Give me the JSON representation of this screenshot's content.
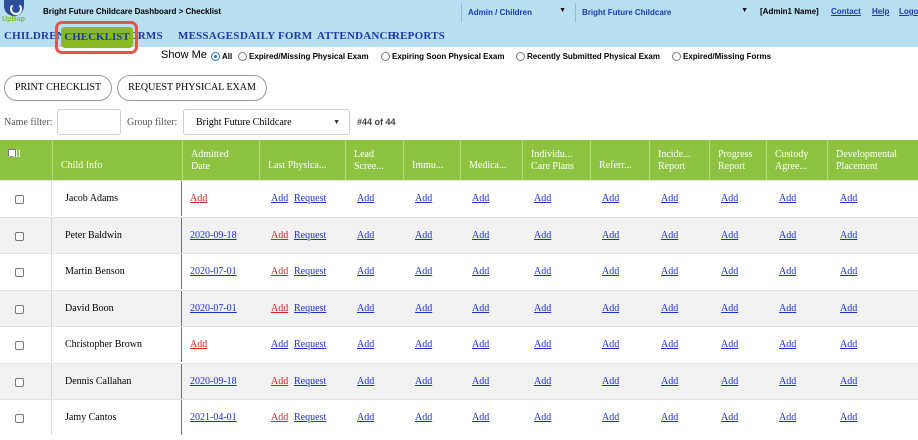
{
  "app": {
    "logo_text": "UpBup",
    "breadcrumb": "Bright Future Childcare Dashboard > Checklist",
    "role_select": "Admin / Children",
    "center_select": "Bright Future Childcare",
    "user": "[Admin1 Name]",
    "links": {
      "contact": "Contact",
      "help": "Help",
      "logout": "Logo"
    }
  },
  "nav": {
    "children": "CHILDREN",
    "checklist": "CHECKLIST",
    "forms": "ORMS",
    "messages": "MESSAGES",
    "daily_form": "DAILY FORM",
    "attendance": "ATTENDANCE",
    "reports": "REPORTS"
  },
  "show_me": {
    "label": "Show Me",
    "options": [
      "All",
      "Expired/Missing Physical Exam",
      "Expiring Soon Physical Exam",
      "Recently Submitted Physical Exam",
      "Expired/Missing Forms"
    ],
    "selected": "All"
  },
  "buttons": {
    "print": "PRINT CHECKLIST",
    "request": "REQUEST PHYSICAL EXAM"
  },
  "filters": {
    "name_label": "Name filter:",
    "name_value": "",
    "group_label": "Group filter:",
    "group_value": "Bright Future Childcare",
    "count": "#44 of 44"
  },
  "table": {
    "all_label": "All",
    "headers": [
      [
        "Child Info"
      ],
      [
        "Admitted",
        "Date"
      ],
      [
        "Last Physica..."
      ],
      [
        "Lead",
        "Scree..."
      ],
      [
        "Immu..."
      ],
      [
        "Medica..."
      ],
      [
        "Individu...",
        "Care Plans"
      ],
      [
        "Referr..."
      ],
      [
        "Incide...",
        "Report"
      ],
      [
        "Progress",
        "Report"
      ],
      [
        "Custody",
        "Agree..."
      ],
      [
        "Developmental",
        "Placement"
      ]
    ],
    "add_label": "Add",
    "request_label": "Request",
    "rows": [
      {
        "name": "Jacob Adams",
        "admitted": "Add"
      },
      {
        "name": "Peter Baldwin",
        "admitted": "2020-09-18"
      },
      {
        "name": "Martin Benson",
        "admitted": "2020-07-01"
      },
      {
        "name": "David Boon",
        "admitted": "2020-07-01"
      },
      {
        "name": "Christopher Brown",
        "admitted": "Add"
      },
      {
        "name": "Dennis Callahan",
        "admitted": "2020-09-18"
      },
      {
        "name": "Jamy Cantos",
        "admitted": "2021-04-01"
      }
    ]
  }
}
